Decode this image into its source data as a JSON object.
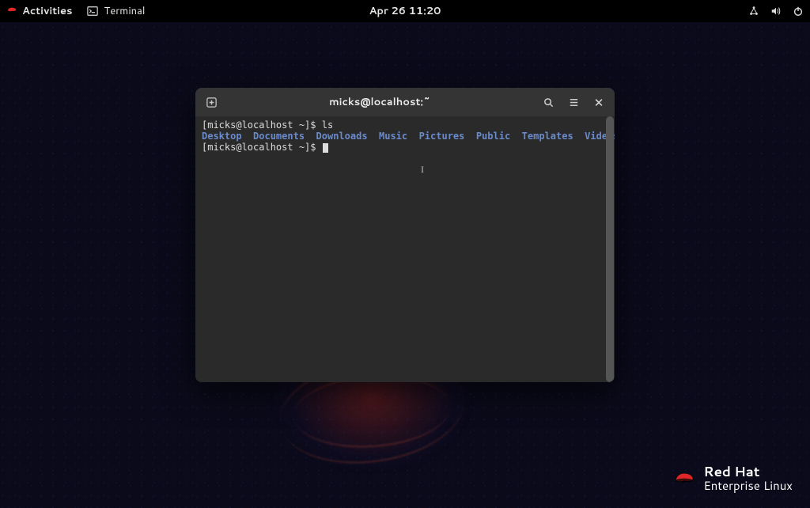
{
  "topbar": {
    "activities_label": "Activities",
    "app_label": "Terminal",
    "datetime": "Apr 26  11:20"
  },
  "terminal": {
    "title": "micks@localhost:~",
    "prompt1": "[micks@localhost ~]$ ",
    "command1": "ls",
    "dirs": [
      "Desktop",
      "Documents",
      "Downloads",
      "Music",
      "Pictures",
      "Public",
      "Templates",
      "Videos"
    ],
    "prompt2": "[micks@localhost ~]$ "
  },
  "brand": {
    "main": "Red Hat",
    "sub": "Enterprise Linux"
  }
}
